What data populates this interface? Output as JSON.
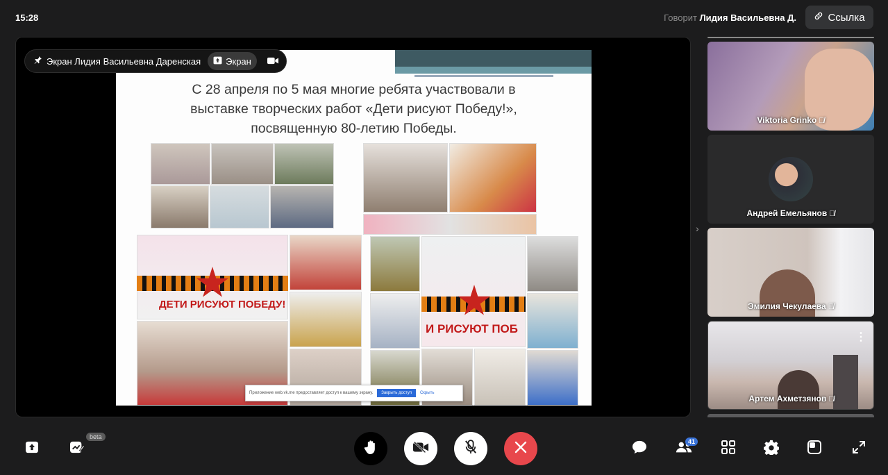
{
  "topbar": {
    "time": "15:28",
    "speaking_label": "Говорит",
    "speaking_name": "Лидия Васильевна Д.",
    "link_label": "Ссылка"
  },
  "screen_share": {
    "pinned_label": "Экран Лидия Васильевна Даренская",
    "screen_tag": "Экран"
  },
  "slide": {
    "line1": "С 28 апреля по 5 мая многие ребята участвовали в",
    "line2": "выставке творческих работ «Дети рисуют Победу!»,",
    "line3": "посвященную 80-летию Победы.",
    "banner1": "ДЕТИ РИСУЮТ ПОБЕДУ!",
    "banner2": "И РИСУЮТ ПОБ",
    "toast_text": "Приложение web.vk.me предоставляет доступ к вашему экрану.",
    "toast_button": "Закрыть доступ",
    "toast_link": "Скрыть"
  },
  "participants": [
    {
      "name": "Viktoria Grinko",
      "type": "video",
      "muted": true
    },
    {
      "name": "Андрей Емельянов",
      "type": "avatar",
      "muted": true
    },
    {
      "name": "Эмилия Чекулаева",
      "type": "video",
      "muted": true
    },
    {
      "name": "Артем Ахметзянов",
      "type": "video",
      "muted": true
    }
  ],
  "bottombar": {
    "beta_label": "beta",
    "participants_count": "41"
  },
  "colors": {
    "background": "#1c1c1d",
    "end_call": "#e8474c",
    "accent": "#3a73d8"
  }
}
